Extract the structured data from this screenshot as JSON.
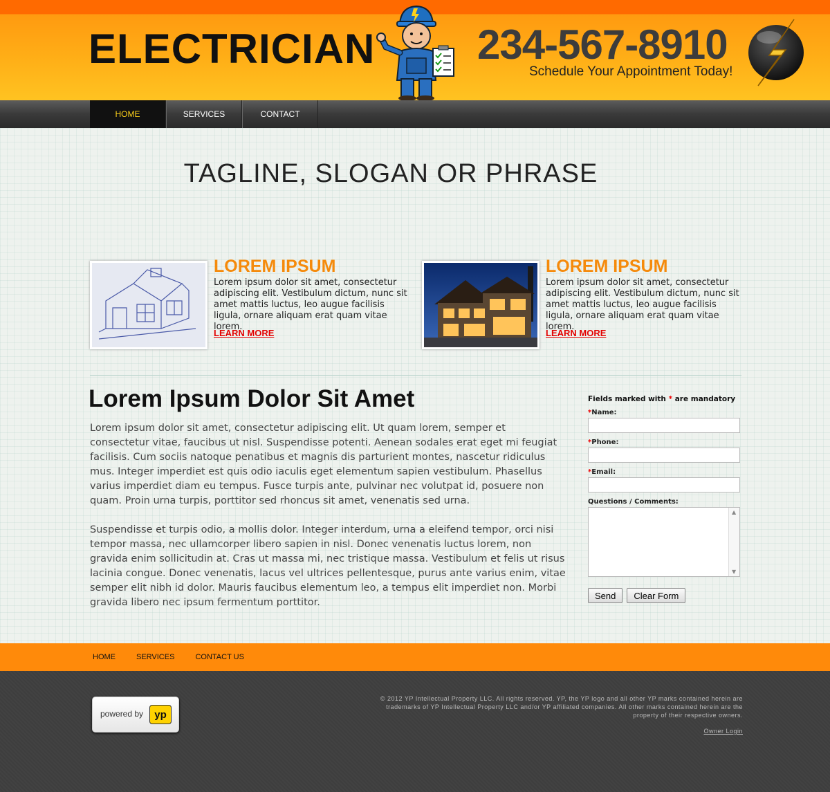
{
  "header": {
    "brand": "ELECTRICIAN",
    "phone": "234-567-8910",
    "schedule": "Schedule Your Appointment Today!"
  },
  "nav": {
    "items": [
      "HOME",
      "SERVICES",
      "CONTACT"
    ],
    "active": "HOME"
  },
  "hero": {
    "tagline": "TAGLINE, SLOGAN OR PHRASE"
  },
  "features": [
    {
      "title": "LOREM IPSUM",
      "text": "Lorem ipsum dolor sit amet, consectetur adipiscing elit. Vestibulum dictum, nunc sit amet mattis luctus, leo augue facilisis ligula, ornare aliquam erat quam vitae lorem.",
      "link": "LEARN MORE"
    },
    {
      "title": "LOREM IPSUM",
      "text": "Lorem ipsum dolor sit amet, consectetur adipiscing elit. Vestibulum dictum, nunc sit amet mattis luctus, leo augue facilisis ligula, ornare aliquam erat quam vitae lorem.",
      "link": "LEARN MORE"
    }
  ],
  "article": {
    "heading": "Lorem Ipsum Dolor Sit Amet",
    "paragraphs": [
      "Lorem ipsum dolor sit amet, consectetur adipiscing elit. Ut quam lorem, semper et consectetur vitae, faucibus ut nisl. Suspendisse potenti. Aenean sodales erat eget mi feugiat facilisis. Cum sociis natoque penatibus et magnis dis parturient montes, nascetur ridiculus mus. Integer imperdiet est quis odio iaculis eget elementum sapien vestibulum. Phasellus varius imperdiet diam eu tempus. Fusce turpis ante, pulvinar nec volutpat id, posuere non quam. Proin urna turpis, porttitor sed rhoncus sit amet, venenatis sed urna.",
      "Suspendisse et turpis odio, a mollis dolor. Integer interdum, urna a eleifend tempor, orci nisi tempor massa, nec ullamcorper libero sapien in nisl. Donec venenatis luctus lorem, non gravida enim sollicitudin at. Cras ut massa mi, nec tristique massa. Vestibulum et felis ut risus lacinia congue. Donec venenatis, lacus vel ultrices pellentesque, purus ante varius enim, vitae semper elit nibh id dolor. Mauris faucibus elementum leo, a tempus elit imperdiet non. Morbi gravida libero nec ipsum fermentum porttitor."
    ]
  },
  "form": {
    "note_prefix": "Fields marked with ",
    "note_star": "*",
    "note_suffix": " are mandatory",
    "required_star": "*",
    "name_label": "Name:",
    "phone_label": "Phone:",
    "email_label": "Email:",
    "comments_label": "Questions / Comments:",
    "name_value": "",
    "phone_value": "",
    "email_value": "",
    "send_label": "Send",
    "clear_label": "Clear Form"
  },
  "footer_nav": {
    "items": [
      "HOME",
      "SERVICES",
      "CONTACT US"
    ]
  },
  "footer": {
    "powered_by": "powered by",
    "yp_logo": "yp",
    "copyright": "© 2012  YP Intellectual Property LLC. All rights reserved. YP, the YP logo and all other YP marks contained herein are trademarks of YP Intellectual Property LLC and/or YP affiliated companies. All other marks contained herein are the property of their respective owners.",
    "owner_login": "Owner Login"
  },
  "colors": {
    "header_orange": "#ff6a00",
    "accent_orange": "#f58a0b",
    "link_red": "#e30000",
    "nav_active": "#ffd21a",
    "footer_dark": "#3e3e3e"
  },
  "icons": [
    "electrician-mascot-icon",
    "lightning-bolt-icon",
    "scroll-up-icon",
    "scroll-down-icon"
  ]
}
